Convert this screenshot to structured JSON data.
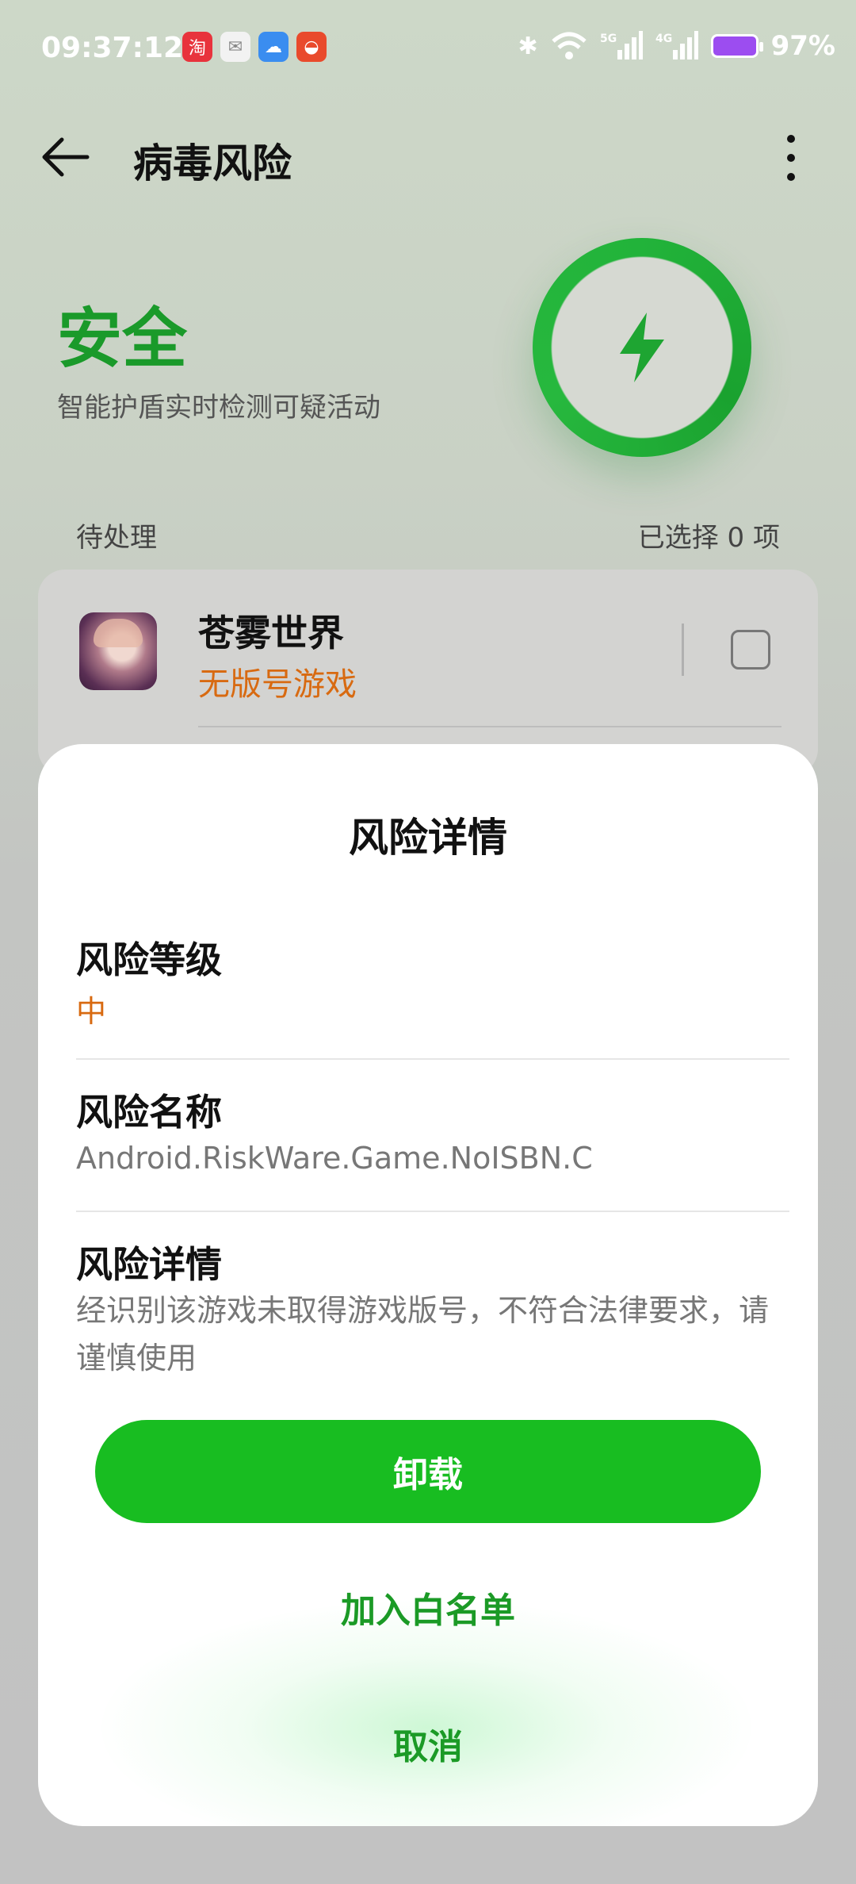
{
  "status_bar": {
    "time": "09:37:12",
    "notification_icons": [
      "taobao-icon",
      "mail-icon",
      "weather-icon",
      "app-icon"
    ],
    "battery": "97%",
    "network_5g": "5G",
    "network_4g": "4G"
  },
  "header": {
    "title": "病毒风险"
  },
  "protection": {
    "status": "安全",
    "subtitle": "智能护盾实时检测可疑活动",
    "accent_color": "#1a9a2a"
  },
  "pending": {
    "label": "待处理",
    "selected": "已选择 0 项"
  },
  "app_item": {
    "name": "苍雾世界",
    "tag": "无版号游戏",
    "tag_color": "#d86a11"
  },
  "risk_sheet": {
    "title": "风险详情",
    "level_label": "风险等级",
    "level_value": "中",
    "name_label": "风险名称",
    "name_value": "Android.RiskWare.Game.NoISBN.C",
    "detail_label": "风险详情",
    "detail_value": "经识别该游戏未取得游戏版号，不符合法律要求，请谨慎使用",
    "uninstall_button": "卸载",
    "whitelist_button": "加入白名单",
    "cancel_button": "取消",
    "button_color": "#18bd21"
  }
}
